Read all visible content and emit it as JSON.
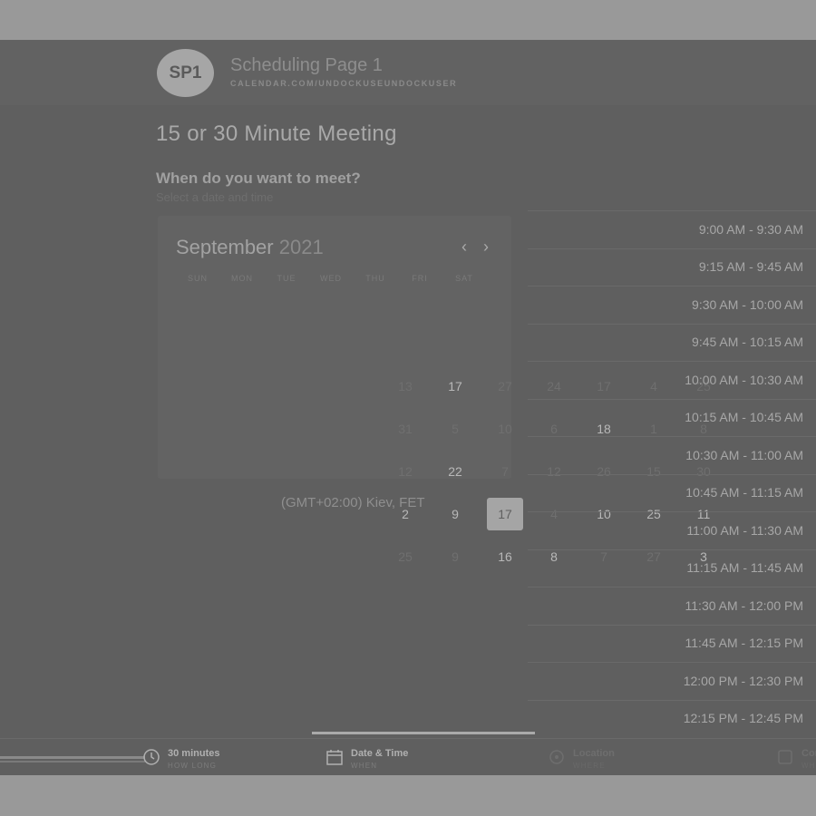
{
  "header": {
    "avatar_text": "SP1",
    "page_name": "Scheduling Page 1",
    "page_url": "CALENDAR.COM/UNDOCKUSEUNDOCKUSER"
  },
  "meeting": {
    "title": "15 or 30 Minute Meeting",
    "question": "When do you want to meet?",
    "subtitle": "Select a date and time"
  },
  "calendar": {
    "month": "September",
    "year": "2021",
    "prev_icon": "chevron-left-icon",
    "next_icon": "chevron-right-icon",
    "weekdays": [
      "SUN",
      "MON",
      "TUE",
      "WED",
      "THU",
      "FRI",
      "SAT"
    ],
    "timezone": "(GMT+02:00) Kiev, FET",
    "grid": [
      [
        "13",
        "17",
        "27",
        "24",
        "17",
        "4",
        "25"
      ],
      [
        "31",
        "5",
        "10",
        "6",
        "18",
        "1",
        "8"
      ],
      [
        "12",
        "22",
        "7",
        "12",
        "26",
        "15",
        "30"
      ],
      [
        "2",
        "9",
        "17",
        "4",
        "10",
        "25",
        "11"
      ],
      [
        "25",
        "9",
        "16",
        "8",
        "7",
        "27",
        "3"
      ]
    ],
    "bright_cells": [
      [
        0,
        1
      ],
      [
        1,
        4
      ],
      [
        2,
        1
      ],
      [
        3,
        0
      ],
      [
        3,
        1
      ],
      [
        3,
        4
      ],
      [
        3,
        5
      ],
      [
        3,
        6
      ],
      [
        4,
        2
      ],
      [
        4,
        3
      ],
      [
        4,
        6
      ]
    ],
    "selected_cell": [
      3,
      2
    ]
  },
  "slots": [
    "9:00 AM - 9:30 AM",
    "9:15 AM - 9:45 AM",
    "9:30 AM - 10:00 AM",
    "9:45 AM - 10:15 AM",
    "10:00 AM - 10:30 AM",
    "10:15 AM - 10:45 AM",
    "10:30 AM - 11:00 AM",
    "10:45 AM - 11:15 AM",
    "11:00 AM - 11:30 AM",
    "11:15 AM - 11:45 AM",
    "11:30 AM - 12:00 PM",
    "11:45 AM - 12:15 PM",
    "12:00 PM - 12:30 PM",
    "12:15 PM - 12:45 PM"
  ],
  "footer": {
    "steps": [
      {
        "label": "30 minutes",
        "sub": "HOW LONG",
        "icon": "clock-icon"
      },
      {
        "label": "Date & Time",
        "sub": "WHEN",
        "icon": "calendar-icon"
      },
      {
        "label": "Location",
        "sub": "WHERE",
        "icon": "location-pin-icon"
      },
      {
        "label": "Confirm",
        "sub": "WHO",
        "icon": "checkbox-icon"
      }
    ]
  },
  "colors": {
    "overlay_bg": "#5f5f5f",
    "frame_bg": "#999999",
    "selected_day_bg": "#a5a5a5"
  }
}
